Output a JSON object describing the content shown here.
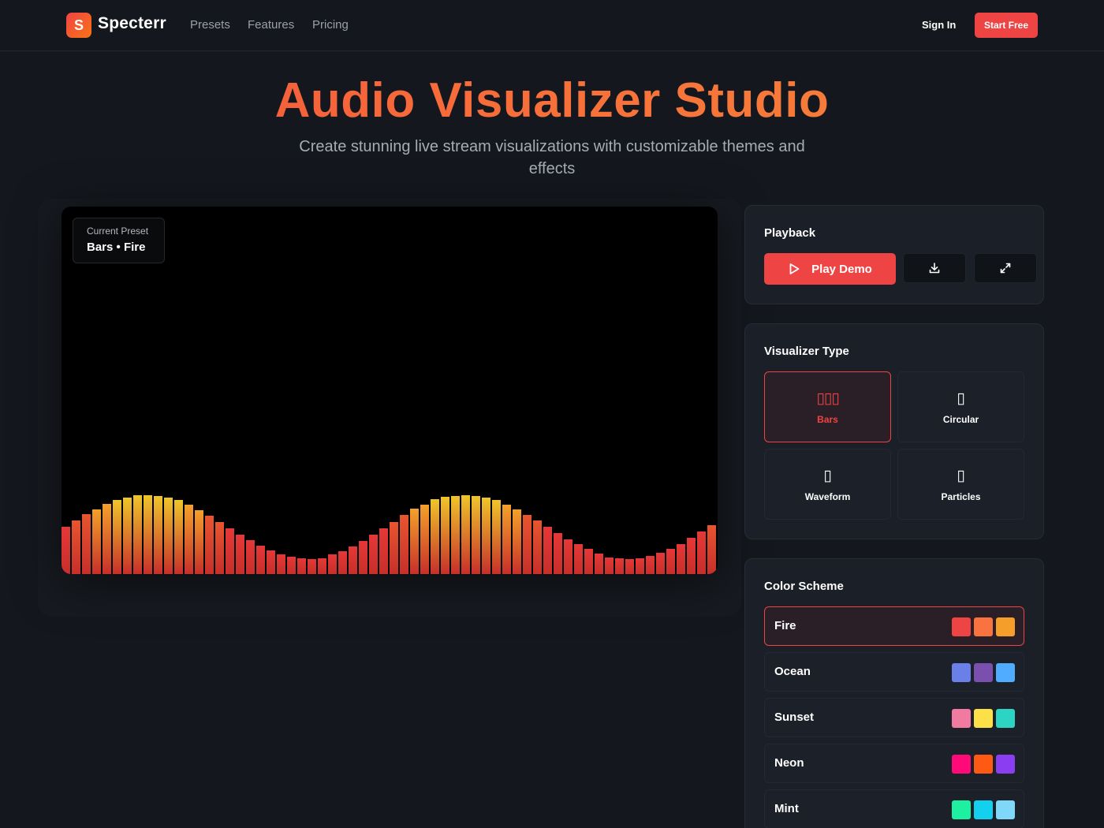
{
  "nav": {
    "logo_letter": "S",
    "brand": "Specterr",
    "links": [
      "Presets",
      "Features",
      "Pricing"
    ],
    "sign_in": "Sign In",
    "start_free": "Start Free"
  },
  "hero": {
    "title": "Audio Visualizer Studio",
    "subtitle": "Create stunning live stream visualizations with customizable themes and effects"
  },
  "canvas": {
    "preset_label": "Current Preset",
    "preset_value": "Bars • Fire",
    "bar_levels": [
      0.6,
      0.68,
      0.76,
      0.82,
      0.89,
      0.94,
      0.97,
      1.0,
      1.0,
      0.99,
      0.97,
      0.94,
      0.88,
      0.81,
      0.74,
      0.66,
      0.58,
      0.5,
      0.43,
      0.36,
      0.3,
      0.25,
      0.22,
      0.2,
      0.19,
      0.2,
      0.25,
      0.29,
      0.35,
      0.42,
      0.5,
      0.58,
      0.66,
      0.75,
      0.83,
      0.88,
      0.95,
      0.98,
      0.99,
      1.0,
      0.99,
      0.97,
      0.94,
      0.88,
      0.82,
      0.75,
      0.68,
      0.6,
      0.52,
      0.44,
      0.38,
      0.32,
      0.26,
      0.21,
      0.2,
      0.19,
      0.2,
      0.23,
      0.27,
      0.32,
      0.38,
      0.46,
      0.54,
      0.62
    ],
    "bar_colors": [
      "#e53838",
      "#e8552f",
      "#ef7a2a",
      "#f3a12a",
      "#efc52a"
    ]
  },
  "playback": {
    "title": "Playback",
    "play_label": "Play Demo"
  },
  "visualizer_type": {
    "title": "Visualizer Type",
    "items": [
      {
        "label": "Bars",
        "glyph": "▯▯▯",
        "active": true
      },
      {
        "label": "Circular",
        "glyph": "▯",
        "active": false
      },
      {
        "label": "Waveform",
        "glyph": "▯",
        "active": false
      },
      {
        "label": "Particles",
        "glyph": "▯",
        "active": false
      }
    ]
  },
  "color_scheme": {
    "title": "Color Scheme",
    "items": [
      {
        "name": "Fire",
        "colors": [
          "#ef4444",
          "#f97340",
          "#f59e2a"
        ],
        "active": true
      },
      {
        "name": "Ocean",
        "colors": [
          "#6b7fe8",
          "#7a4fad",
          "#4facfe"
        ],
        "active": false
      },
      {
        "name": "Sunset",
        "colors": [
          "#f17ba0",
          "#fde047",
          "#2dd4c4"
        ],
        "active": false
      },
      {
        "name": "Neon",
        "colors": [
          "#ff0a78",
          "#ff5a14",
          "#8b3df2"
        ],
        "active": false
      },
      {
        "name": "Mint",
        "colors": [
          "#1ef0a2",
          "#12d0ee",
          "#7fd8f8"
        ],
        "active": false
      }
    ]
  }
}
